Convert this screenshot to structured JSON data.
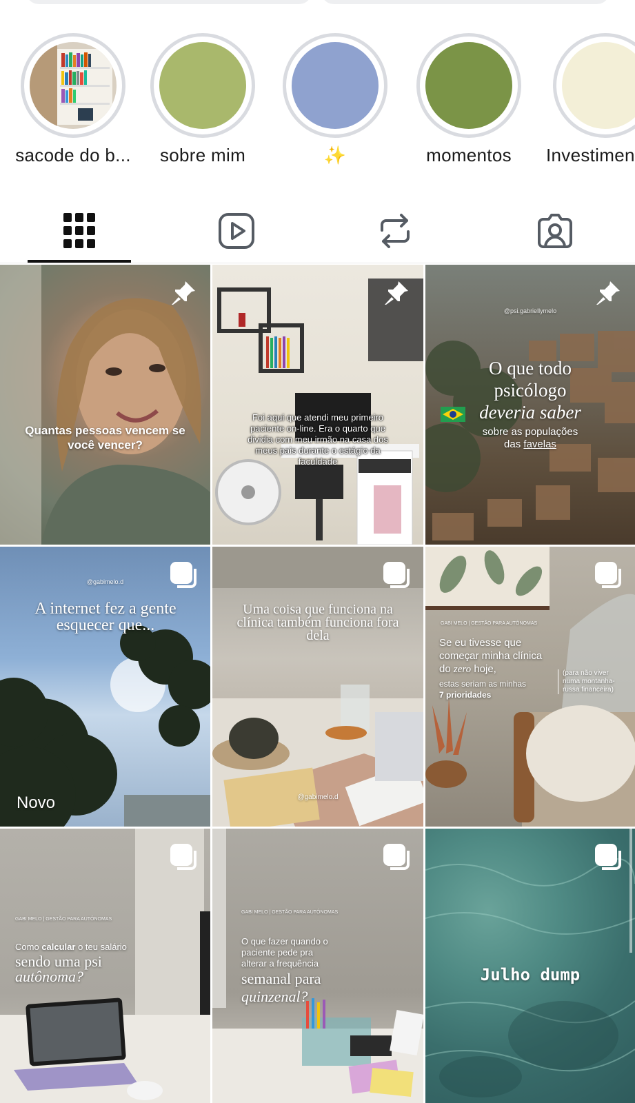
{
  "highlights": [
    {
      "label": "sacode do b...",
      "color": "#8a7a63"
    },
    {
      "label": "sobre mim",
      "color": "#a9b86c"
    },
    {
      "label": "✨",
      "color": "#8fa2cf"
    },
    {
      "label": "momentos",
      "color": "#7b9447"
    },
    {
      "label": "Investimen",
      "color": "#f3efd7"
    }
  ],
  "tabs": [
    {
      "name": "grid-icon",
      "active": true
    },
    {
      "name": "reels-icon",
      "active": false
    },
    {
      "name": "reposts-icon",
      "active": false
    },
    {
      "name": "tagged-icon",
      "active": false
    }
  ],
  "posts": [
    {
      "caption": "Quantas pessoas vencem se você vencer?",
      "badge": "pin-icon"
    },
    {
      "caption": "Foi aqui que atendi meu primeiro paciente on-line. Era o quarto que dividia com meu irmão na casa dos meus pais durante o estágio da faculdade",
      "badge": "pin-icon"
    },
    {
      "handle": "@psi.gabriellymelo",
      "title_1": "O que todo",
      "title_2": "psicólogo",
      "title_3": "deveria saber",
      "sub_1": "sobre as populações",
      "sub_2": "das",
      "sub_link": "favelas",
      "badge": "pin-icon"
    },
    {
      "handle": "@gabimelo.d",
      "title": "A internet fez a gente esquecer que...",
      "tag": "Novo",
      "badge": "carousel-icon"
    },
    {
      "title": "Uma coisa que funciona na clínica também funciona fora dela",
      "handle": "@gabimelo.d",
      "badge": "carousel-icon"
    },
    {
      "header": "GABI MELO | GESTÃO PARA AUTÔNOMAS",
      "title_1": "Se eu tivesse que começar minha clínica do",
      "title_em": "zero",
      "title_2": "hoje,",
      "sub": "estas seriam as minhas",
      "sub_bold": "7 prioridades",
      "note": "(para não viver numa montanha-russa financeira)",
      "badge": "carousel-icon"
    },
    {
      "header": "GABI MELO | GESTÃO PARA AUTÔNOMAS",
      "line_1": "Como",
      "line_1b": "calcular",
      "line_1c": "o teu salário",
      "line_2": "sendo uma psi",
      "line_3": "autônoma?",
      "badge": "carousel-icon"
    },
    {
      "header": "GABI MELO | GESTÃO PARA AUTÔNOMAS",
      "line_1": "O que fazer quando o paciente pede pra alterar a frequência",
      "line_2": "semanal para",
      "line_3": "quinzenal?",
      "badge": "carousel-icon"
    },
    {
      "title": "Julho dump",
      "badge": "carousel-icon"
    }
  ]
}
